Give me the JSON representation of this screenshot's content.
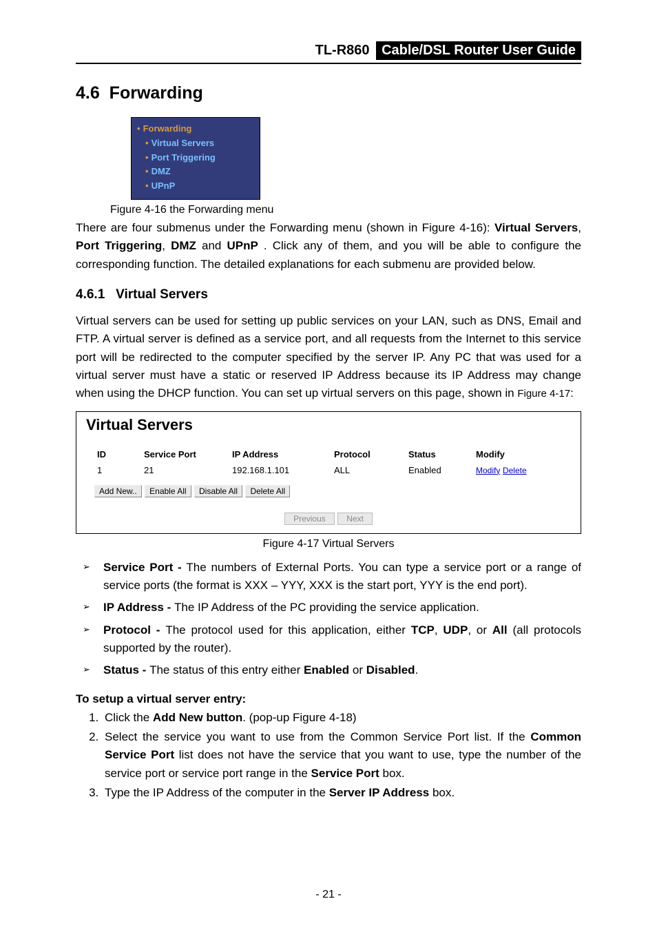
{
  "header": {
    "model": "TL-R860",
    "title": "Cable/DSL  Router  User  Guide"
  },
  "section": {
    "number": "4.6",
    "name": "Forwarding"
  },
  "menu": {
    "top": "Forwarding",
    "items": [
      "Virtual Servers",
      "Port Triggering",
      "DMZ",
      "UPnP"
    ]
  },
  "figure16_caption": "Figure 4-16 the Forwarding menu",
  "para_intro_pre": "There are four submenus under the Forwarding menu (shown in Figure 4-16): ",
  "para_intro_bold": {
    "vs": "Virtual Servers",
    "pt": "Port Triggering",
    "dmz": "DMZ",
    "upnp": "UPnP"
  },
  "para_intro_mid": ". Click any of them, and you will be able to configure the corresponding function. The detailed explanations for each submenu are provided below.",
  "subsection": {
    "number": "4.6.1",
    "name": "Virtual Servers"
  },
  "para_vs": "Virtual servers can be used for setting up public services on your LAN, such as DNS, Email and FTP. A virtual server is defined as a service port, and all requests from the Internet to this service port will be redirected to the computer specified by the server IP. Any PC that was used for a virtual server must have a static or reserved IP Address because its IP Address may change when using the DHCP function. You can set up virtual servers on this page, shown in ",
  "para_vs_figref": "Figure 4-17",
  "para_vs_end": ":",
  "vs": {
    "title": "Virtual Servers",
    "headers": [
      "ID",
      "Service Port",
      "IP Address",
      "Protocol",
      "Status",
      "Modify"
    ],
    "row": {
      "id": "1",
      "port": "21",
      "ip": "192.168.1.101",
      "proto": "ALL",
      "status": "Enabled",
      "modify": "Modify",
      "delete": "Delete"
    },
    "buttons": {
      "add": "Add New..",
      "enable": "Enable All",
      "disable": "Disable All",
      "delete": "Delete All"
    },
    "pager": {
      "prev": "Previous",
      "next": "Next"
    }
  },
  "figure17_caption": "Figure 4-17 Virtual Servers",
  "bullets": {
    "b1_term": "Service Port - ",
    "b1_text": "The numbers of External Ports. You can type a service port or a range of service ports (the format is XXX – YYY, XXX is the start port, YYY is the end port).",
    "b2_term": "IP Address - ",
    "b2_text": "The IP Address of the PC providing the service application.",
    "b3_term": "Protocol - ",
    "b3_text_a": "The protocol used for this application, either ",
    "b3_tcp": "TCP",
    "b3_comma1": ", ",
    "b3_udp": "UDP",
    "b3_comma2": ", or ",
    "b3_all": "All",
    "b3_text_b": " (all protocols supported by the router).",
    "b4_term": "Status - ",
    "b4_text_a": "The status of this entry either ",
    "b4_en": "Enabled",
    "b4_or": " or ",
    "b4_dis": "Disabled",
    "b4_dot": "."
  },
  "setup_heading": "To setup a virtual server entry:",
  "steps": {
    "s1_a": "Click the ",
    "s1_b": "Add New button",
    "s1_c": ". (pop-up Figure 4-18)",
    "s2_a": "Select the service you want to use from the Common Service Port list. If the ",
    "s2_b": "Common Service Port",
    "s2_c": " list does not have the service that you want to use, type the number of the service port or service port range in the ",
    "s2_d": "Service Port",
    "s2_e": " box.",
    "s3_a": "Type the IP Address of the computer in the ",
    "s3_b": "Server IP Address",
    "s3_c": " box."
  },
  "page_number": "- 21 -"
}
